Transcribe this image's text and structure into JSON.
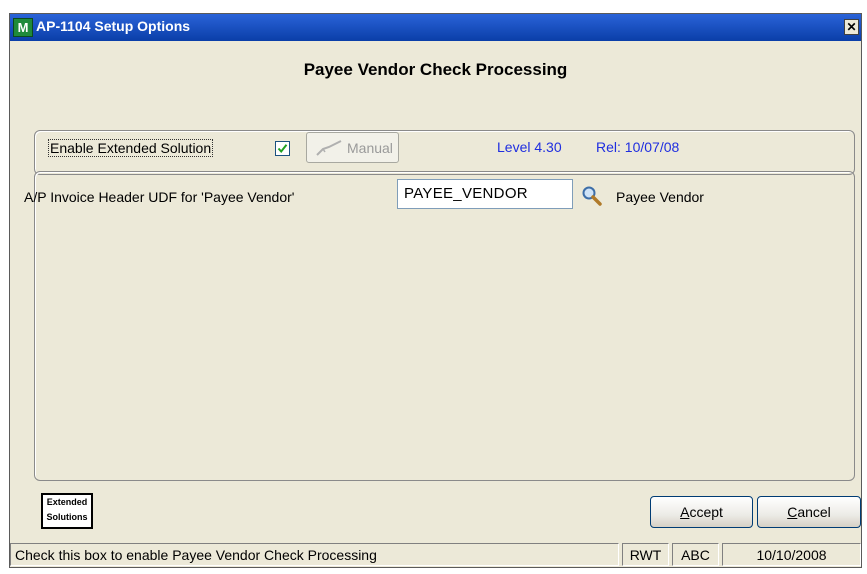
{
  "window": {
    "title": "AP-1104 Setup Options",
    "app_icon": "MAS-app-icon",
    "close_glyph": "✕"
  },
  "heading": "Payee Vendor Check Processing",
  "options": {
    "enable_label": "Enable Extended Solution",
    "enable_checked": true,
    "manual_label": "Manual",
    "level": "Level 4.30",
    "release": "Rel: 10/07/08"
  },
  "udf": {
    "label": "A/P Invoice Header UDF for 'Payee Vendor'",
    "value": "PAYEE_VENDOR",
    "description": "Payee Vendor",
    "lookup_icon": "magnifier-icon"
  },
  "logo": {
    "line1": "Extended",
    "line2": "Solutions"
  },
  "buttons": {
    "accept_prefix": "A",
    "accept_rest": "ccept",
    "cancel_prefix": "C",
    "cancel_rest": "ancel"
  },
  "statusbar": {
    "message": "Check this box to enable Payee Vendor Check Processing",
    "mode": "RWT",
    "company": "ABC",
    "date": "10/10/2008"
  },
  "colors": {
    "titlebar": "#0a3ea8",
    "window_bg": "#ece9d8",
    "info_text": "#1f2ee0",
    "checkmark": "#21a121"
  }
}
